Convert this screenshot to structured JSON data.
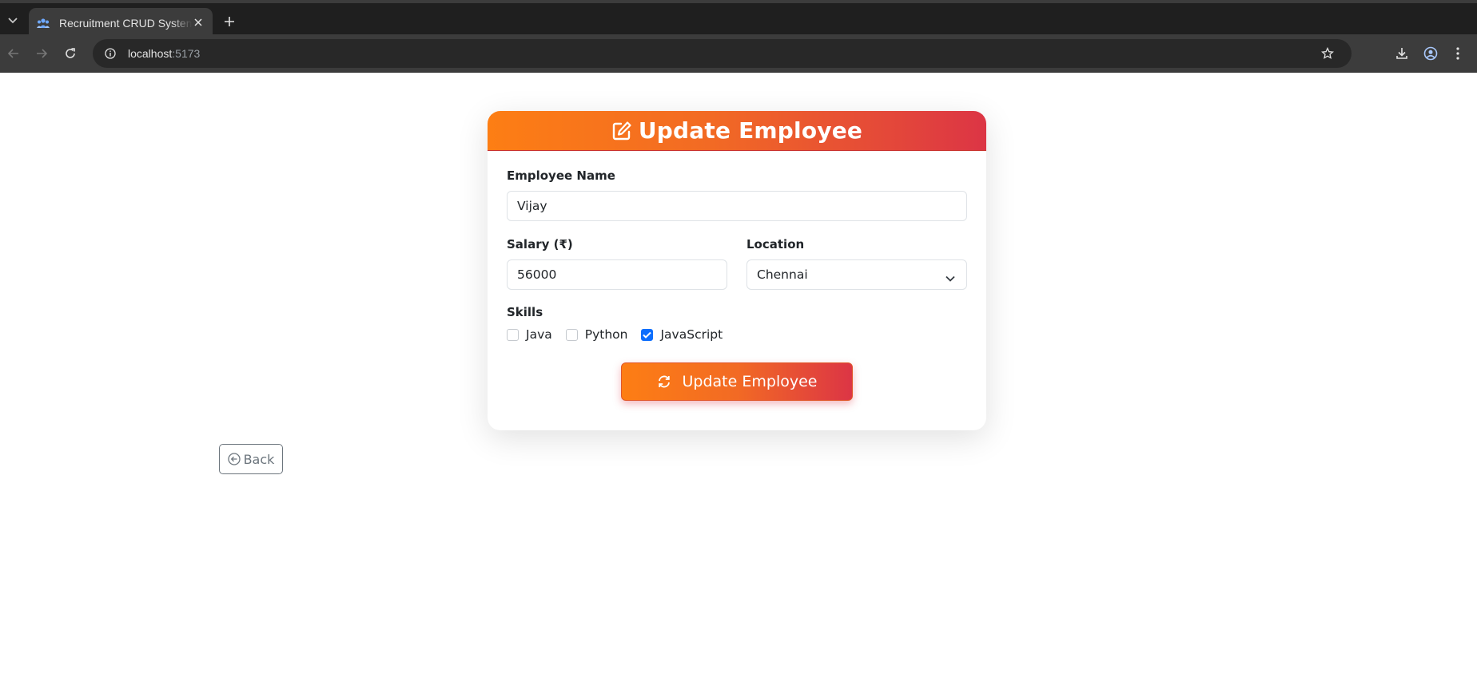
{
  "browser": {
    "tab_title": "Recruitment CRUD System",
    "url_host": "localhost",
    "url_port": ":5173"
  },
  "card": {
    "title": "Update Employee",
    "name_label": "Employee Name",
    "name_value": "Vijay",
    "salary_label": "Salary (₹)",
    "salary_value": "56000",
    "location_label": "Location",
    "location_value": "Chennai",
    "skills_label": "Skills",
    "skills": [
      {
        "label": "Java",
        "checked": false
      },
      {
        "label": "Python",
        "checked": false
      },
      {
        "label": "JavaScript",
        "checked": true
      }
    ],
    "submit_label": "Update Employee"
  },
  "back_label": "Back",
  "colors": {
    "gradient_start": "#fd7e14",
    "gradient_end": "#dc3545",
    "checkbox_checked": "#0d6efd",
    "back_border": "#6c757d"
  }
}
